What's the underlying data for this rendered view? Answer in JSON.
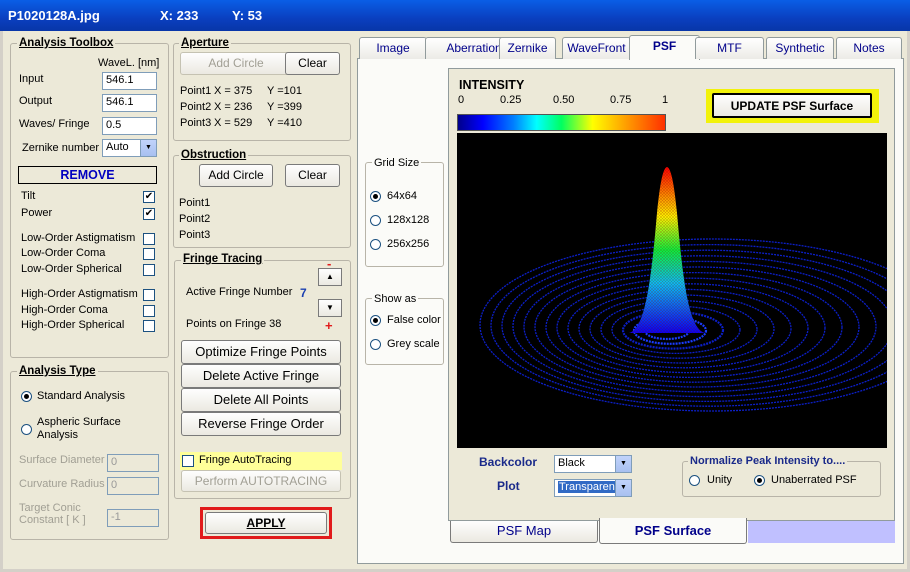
{
  "window": {
    "filename": "P1020128A.jpg",
    "x_label": "X: 233",
    "y_label": "Y: 53"
  },
  "toolbox": {
    "title": "Analysis Toolbox",
    "wavelength_header": "WaveL. [nm]",
    "input_label": "Input",
    "input_value": "546.1",
    "output_label": "Output",
    "output_value": "546.1",
    "waves_label": "Waves/ Fringe",
    "waves_value": "0.5",
    "zernike_label": "Zernike number",
    "zernike_value": "Auto",
    "remove_label": "REMOVE",
    "terms": [
      {
        "label": "Tilt",
        "checked": true
      },
      {
        "label": "Power",
        "checked": true
      },
      {
        "label": "Low-Order  Astigmatism",
        "checked": false
      },
      {
        "label": "Low-Order  Coma",
        "checked": false
      },
      {
        "label": "Low-Order  Spherical",
        "checked": false
      },
      {
        "label": "High-Order  Astigmatism",
        "checked": false
      },
      {
        "label": "High-Order  Coma",
        "checked": false
      },
      {
        "label": "High-Order  Spherical",
        "checked": false
      }
    ]
  },
  "analysis": {
    "title": "Analysis Type",
    "standard": "Standard  Analysis",
    "aspheric_1": "Aspheric  Surface",
    "aspheric_2": "Analysis",
    "surface_diameter": "Surface Diameter",
    "surface_diameter_value": "0",
    "curvature_radius": "Curvature Radius",
    "curvature_radius_value": "0",
    "target_conic_1": "Target Conic",
    "target_conic_2": "Constant [ K ]",
    "target_conic_value": "-1"
  },
  "aperture": {
    "title": "Aperture",
    "add_circle": "Add Circle",
    "clear": "Clear",
    "points": [
      {
        "label": "Point1",
        "x": "X =   375",
        "y": "Y =101"
      },
      {
        "label": "Point2",
        "x": "X =   236",
        "y": "Y =399"
      },
      {
        "label": "Point3",
        "x": "X =   529",
        "y": "Y =410"
      }
    ]
  },
  "obstruction": {
    "title": "Obstruction",
    "add_circle": "Add Circle",
    "clear": "Clear",
    "points": [
      "Point1",
      "Point2",
      "Point3"
    ]
  },
  "fringe": {
    "title": "Fringe Tracing",
    "minus": "-",
    "plus": "+",
    "active_label": "Active Fringe Number",
    "active_value": "7",
    "points_label": "Points on  Fringe 38",
    "optimize": "Optimize Fringe Points",
    "delete_active": "Delete Active Fringe",
    "delete_all": "Delete  All  Points",
    "reverse": "Reverse  Fringe Order",
    "autotracing": "Fringe AutoTracing",
    "perform": "Perform  AUTOTRACING"
  },
  "apply": "APPLY",
  "tabs": [
    "Image",
    "Aberration",
    "Zernike",
    "WaveFront",
    "PSF",
    "MTF",
    "Synthetic",
    "Notes"
  ],
  "active_tab": "PSF",
  "grid": {
    "title": "Grid Size",
    "options": [
      "64x64",
      "128x128",
      "256x256"
    ],
    "selected": "64x64"
  },
  "show_as": {
    "title": "Show as",
    "options": [
      "False color",
      "Grey scale"
    ],
    "selected": "False color"
  },
  "intensity": {
    "title": "INTENSITY",
    "ticks": [
      "0",
      "0.25",
      "0.50",
      "0.75",
      "1"
    ]
  },
  "update_button": "UPDATE  PSF  Surface",
  "backcolor_label": "Backcolor",
  "backcolor_value": "Black",
  "plot_label": "Plot",
  "plot_value": "Transparent",
  "normalize": {
    "title": "Normalize Peak Intensity to....",
    "options": [
      "Unity",
      "Unaberrated PSF"
    ],
    "selected": "Unaberrated PSF"
  },
  "bottom_tabs": [
    "PSF   Map",
    "PSF Surface"
  ],
  "active_bottom_tab": "PSF Surface",
  "colors": {
    "accent_red": "#e11b1b",
    "update_yellow": "#f2f20a",
    "plot_bg": "#000000",
    "fringe_number_blue": "#1a3fb0"
  }
}
